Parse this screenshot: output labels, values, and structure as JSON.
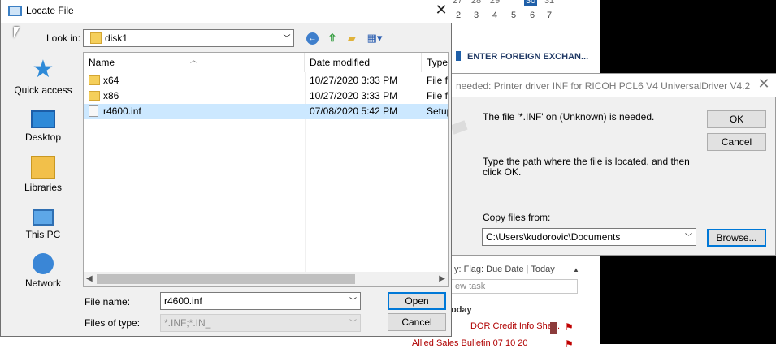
{
  "background_app": {
    "calendar_top": [
      "27",
      "28",
      "29",
      "30",
      "31"
    ],
    "calendar_days": [
      "2",
      "3",
      "4",
      "5",
      "6",
      "7"
    ],
    "heading": "ENTER FOREIGN EXCHAN...",
    "arrange_by": "y: Flag: Due Date",
    "arrange_today": "Today",
    "new_task_placeholder": "ew task",
    "today_header": "oday",
    "tasks": [
      {
        "title": "DOR Credit Info She..."
      },
      {
        "title": "Allied Sales Bulletin 07 10 20"
      }
    ]
  },
  "locate_dialog": {
    "title": "Locate File",
    "close": "✕",
    "look_in_label": "Look in:",
    "look_in_value": "disk1",
    "places": [
      {
        "label": "Quick access",
        "icon": "quick-access-icon"
      },
      {
        "label": "Desktop",
        "icon": "desktop-icon"
      },
      {
        "label": "Libraries",
        "icon": "libraries-icon"
      },
      {
        "label": "This PC",
        "icon": "this-pc-icon"
      },
      {
        "label": "Network",
        "icon": "network-icon"
      }
    ],
    "columns": {
      "name": "Name",
      "date": "Date modified",
      "type": "Type"
    },
    "files": [
      {
        "name": "x64",
        "date": "10/27/2020 3:33 PM",
        "type": "File fo",
        "kind": "folder"
      },
      {
        "name": "x86",
        "date": "10/27/2020 3:33 PM",
        "type": "File fo",
        "kind": "folder"
      },
      {
        "name": "r4600.inf",
        "date": "07/08/2020 5:42 PM",
        "type": "Setup",
        "kind": "file"
      }
    ],
    "selected_file_index": 2,
    "file_name_label": "File name:",
    "file_name_value": "r4600.inf",
    "file_type_label": "Files of type:",
    "file_type_value": "*.INF;*.IN_",
    "open_label": "Open",
    "cancel_label": "Cancel"
  },
  "files_needed_dialog": {
    "title": "needed: Printer driver INF for RICOH PCL6 V4 UniversalDriver V4.2",
    "close": "✕",
    "message1": "The file '*.INF' on (Unknown) is needed.",
    "message2": "Type the path where the file is located, and then click OK.",
    "copy_from_label": "Copy files from:",
    "copy_from_value": "C:\\Users\\kudorovic\\Documents",
    "ok_label": "OK",
    "cancel_label": "Cancel",
    "browse_label": "Browse..."
  },
  "colors": {
    "selection": "#cce8ff",
    "accent": "#0078d7",
    "task_red": "#b00000"
  }
}
